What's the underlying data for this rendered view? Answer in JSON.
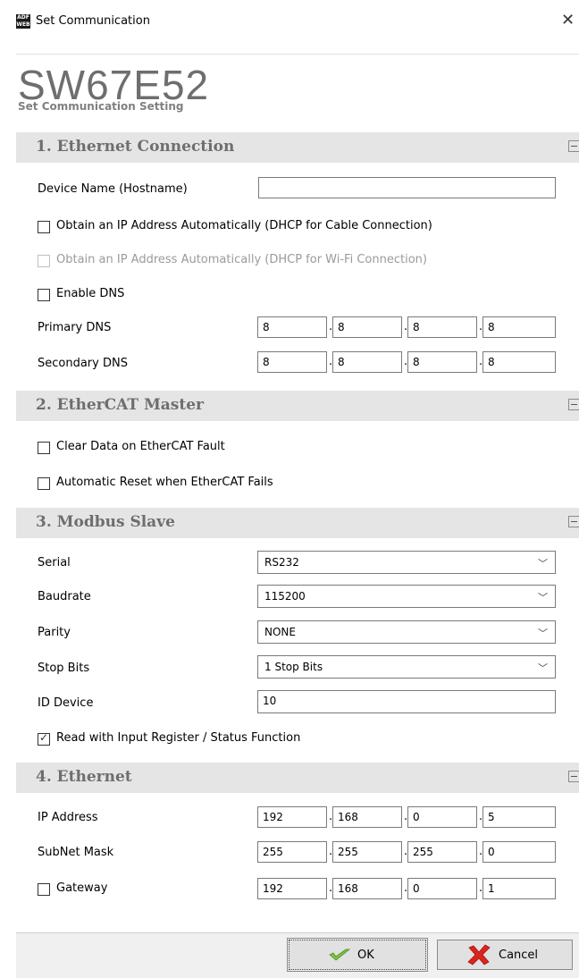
{
  "window": {
    "title": "Set Communication",
    "icon_text": "ADF WEB",
    "close_icon": "close-icon"
  },
  "header": {
    "product_code": "SW67E52",
    "subtitle": "Set Communication Setting"
  },
  "ethernet_connection": {
    "title": "1. Ethernet Connection",
    "device_name_label": "Device Name (Hostname)",
    "device_name_value": "",
    "dhcp_cable_label": "Obtain an IP Address Automatically (DHCP for Cable Connection)",
    "dhcp_cable_checked": false,
    "dhcp_wifi_label": "Obtain an IP Address Automatically (DHCP for Wi-Fi Connection)",
    "dhcp_wifi_enabled": false,
    "enable_dns_label": "Enable DNS",
    "enable_dns_checked": false,
    "primary_dns_label": "Primary DNS",
    "primary_dns": [
      "8",
      "8",
      "8",
      "8"
    ],
    "secondary_dns_label": "Secondary DNS",
    "secondary_dns": [
      "8",
      "8",
      "8",
      "8"
    ]
  },
  "ethercat_master": {
    "title": "2. EtherCAT Master",
    "clear_data_label": "Clear Data on EtherCAT Fault",
    "clear_data_checked": false,
    "auto_reset_label": "Automatic Reset when EtherCAT Fails",
    "auto_reset_checked": false
  },
  "modbus_slave": {
    "title": "3. Modbus Slave",
    "serial_label": "Serial",
    "serial_value": "RS232",
    "baudrate_label": "Baudrate",
    "baudrate_value": "115200",
    "parity_label": "Parity",
    "parity_value": "NONE",
    "stop_bits_label": "Stop Bits",
    "stop_bits_value": "1 Stop Bits",
    "id_device_label": "ID Device",
    "id_device_value": "10",
    "read_input_label": "Read with Input Register / Status Function",
    "read_input_checked": true
  },
  "ethernet": {
    "title": "4. Ethernet",
    "ip_label": "IP Address",
    "ip": [
      "192",
      "168",
      "0",
      "5"
    ],
    "subnet_label": "SubNet Mask",
    "subnet": [
      "255",
      "255",
      "255",
      "0"
    ],
    "gateway_label": "Gateway",
    "gateway_checked": false,
    "gateway": [
      "192",
      "168",
      "0",
      "1"
    ]
  },
  "footer": {
    "ok_label": "OK",
    "cancel_label": "Cancel"
  },
  "colors": {
    "section_bg": "#e5e5e5",
    "section_title": "#6e6e6e",
    "ok_icon": "#7cc242",
    "cancel_icon": "#d9251d"
  }
}
